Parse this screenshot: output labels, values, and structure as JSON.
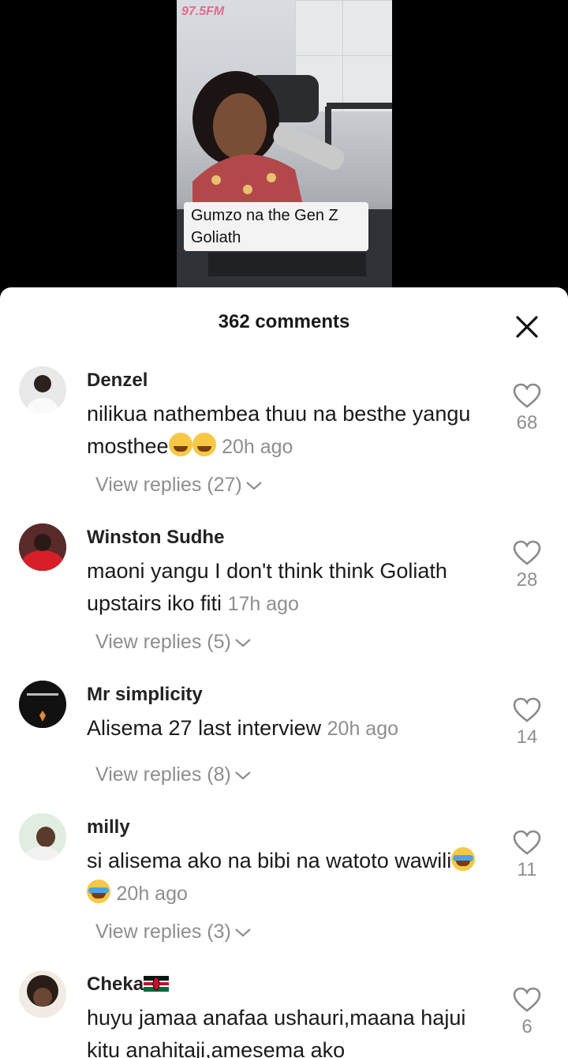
{
  "video": {
    "station_logo": "97.5FM",
    "caption": "Gumzo na the Gen Z Goliath"
  },
  "sheet": {
    "comment_count": "362 comments"
  },
  "colors": {
    "sheet_bg": "#ffffff",
    "muted_text": "#8e8e8e",
    "primary_text": "#1a1a1a",
    "backdrop": "#000000"
  },
  "comments": [
    {
      "username": "Denzel",
      "text": "nilikua nathembea thuu na besthe yangu mosthee",
      "emoji": [
        "face-with-tears-of-joy",
        "face-with-tears-of-joy"
      ],
      "time": "20h ago",
      "replies": "View replies (27)",
      "likes": "68"
    },
    {
      "username": "Winston Sudhe",
      "text": "maoni yangu I don't think think Goliath upstairs iko fiti",
      "time": "17h ago",
      "replies": "View replies (5)",
      "likes": "28"
    },
    {
      "username": "Mr simplicity",
      "text": "Alisema 27 last interview",
      "time": "20h ago",
      "replies": "View replies (8)",
      "likes": "14"
    },
    {
      "username": "milly",
      "text": "si alisema ako na bibi na watoto wawili",
      "emoji": [
        "loudly-crying-face",
        "loudly-crying-face"
      ],
      "time": "20h ago",
      "replies": "View replies (3)",
      "likes": "11"
    },
    {
      "username": "Cheka",
      "username_flag": "kenya-flag",
      "text": "huyu jamaa anafaa ushauri,maana hajui kitu anahitaji,amesema ako",
      "likes": "6"
    }
  ]
}
